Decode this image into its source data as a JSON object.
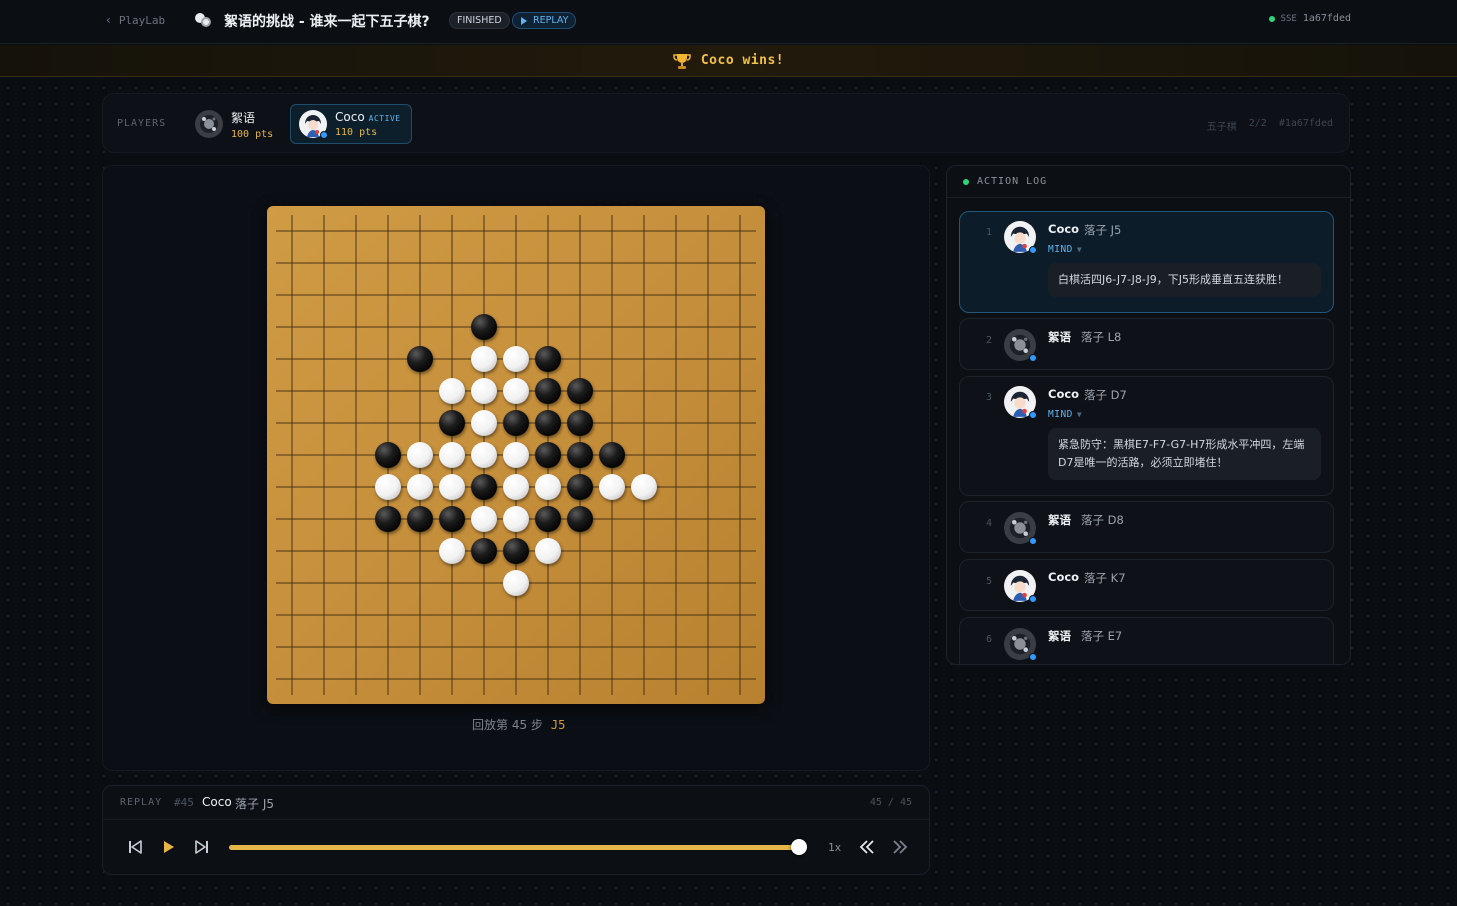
{
  "topbar": {
    "back_label": "PlayLab",
    "title": "絮语的挑战 - 谁来一起下五子棋?",
    "status_badge": "FINISHED",
    "replay_badge": "REPLAY",
    "connection": "SSE",
    "game_id": "1a67fded"
  },
  "banner": {
    "text": "Coco wins!"
  },
  "players": {
    "label": "PLAYERS",
    "list": [
      {
        "name": "絮语",
        "points": "100 pts",
        "active": false
      },
      {
        "name": "Coco",
        "points": "110 pts",
        "active": true,
        "active_label": "ACTIVE"
      }
    ],
    "meta": {
      "game": "五子棋",
      "count": "2/2",
      "id": "#1a67fded"
    }
  },
  "board": {
    "size": 15,
    "caption": "回放第 45 步",
    "caption_move": "J5",
    "black": [
      [
        6,
        3
      ],
      [
        4,
        4
      ],
      [
        8,
        4
      ],
      [
        8,
        5
      ],
      [
        9,
        5
      ],
      [
        5,
        6
      ],
      [
        7,
        6
      ],
      [
        8,
        6
      ],
      [
        9,
        6
      ],
      [
        3,
        7
      ],
      [
        8,
        7
      ],
      [
        9,
        7
      ],
      [
        10,
        7
      ],
      [
        6,
        8
      ],
      [
        9,
        8
      ],
      [
        3,
        9
      ],
      [
        4,
        9
      ],
      [
        5,
        9
      ],
      [
        8,
        9
      ],
      [
        9,
        9
      ],
      [
        6,
        10
      ],
      [
        7,
        10
      ]
    ],
    "white": [
      [
        6,
        4
      ],
      [
        7,
        4
      ],
      [
        5,
        5
      ],
      [
        6,
        5
      ],
      [
        7,
        5
      ],
      [
        6,
        6
      ],
      [
        4,
        7
      ],
      [
        5,
        7
      ],
      [
        6,
        7
      ],
      [
        7,
        7
      ],
      [
        3,
        8
      ],
      [
        4,
        8
      ],
      [
        5,
        8
      ],
      [
        7,
        8
      ],
      [
        8,
        8
      ],
      [
        10,
        8
      ],
      [
        11,
        8
      ],
      [
        6,
        9
      ],
      [
        7,
        9
      ],
      [
        5,
        10
      ],
      [
        8,
        10
      ],
      [
        7,
        11
      ]
    ]
  },
  "replay": {
    "label": "REPLAY",
    "move_number": "#45",
    "player": "Coco",
    "action": "落子 J5",
    "counter": "45 / 45",
    "progress": 1.0,
    "speed": "1x"
  },
  "log": {
    "title": "ACTION LOG",
    "entries": [
      {
        "index": "1",
        "player": "Coco",
        "action": "落子 J5",
        "mind": "MIND",
        "thought": "白棋活四J6-J7-J8-J9，下J5形成垂直五连获胜！",
        "highlight": true
      },
      {
        "index": "2",
        "player": "絮语",
        "action": "落子 L8"
      },
      {
        "index": "3",
        "player": "Coco",
        "action": "落子 D7",
        "mind": "MIND",
        "thought": "紧急防守：黑棋E7-F7-G7-H7形成水平冲四，左端D7是唯一的活路，必须立即堵住！"
      },
      {
        "index": "4",
        "player": "絮语",
        "action": "落子 D8"
      },
      {
        "index": "5",
        "player": "Coco",
        "action": "落子 K7"
      },
      {
        "index": "6",
        "player": "絮语",
        "action": "落子 E7"
      }
    ]
  },
  "colors": {
    "accent": "#5fb4f0",
    "gold": "#e5b547",
    "board": "#c6913e",
    "online": "#2ed47a"
  }
}
